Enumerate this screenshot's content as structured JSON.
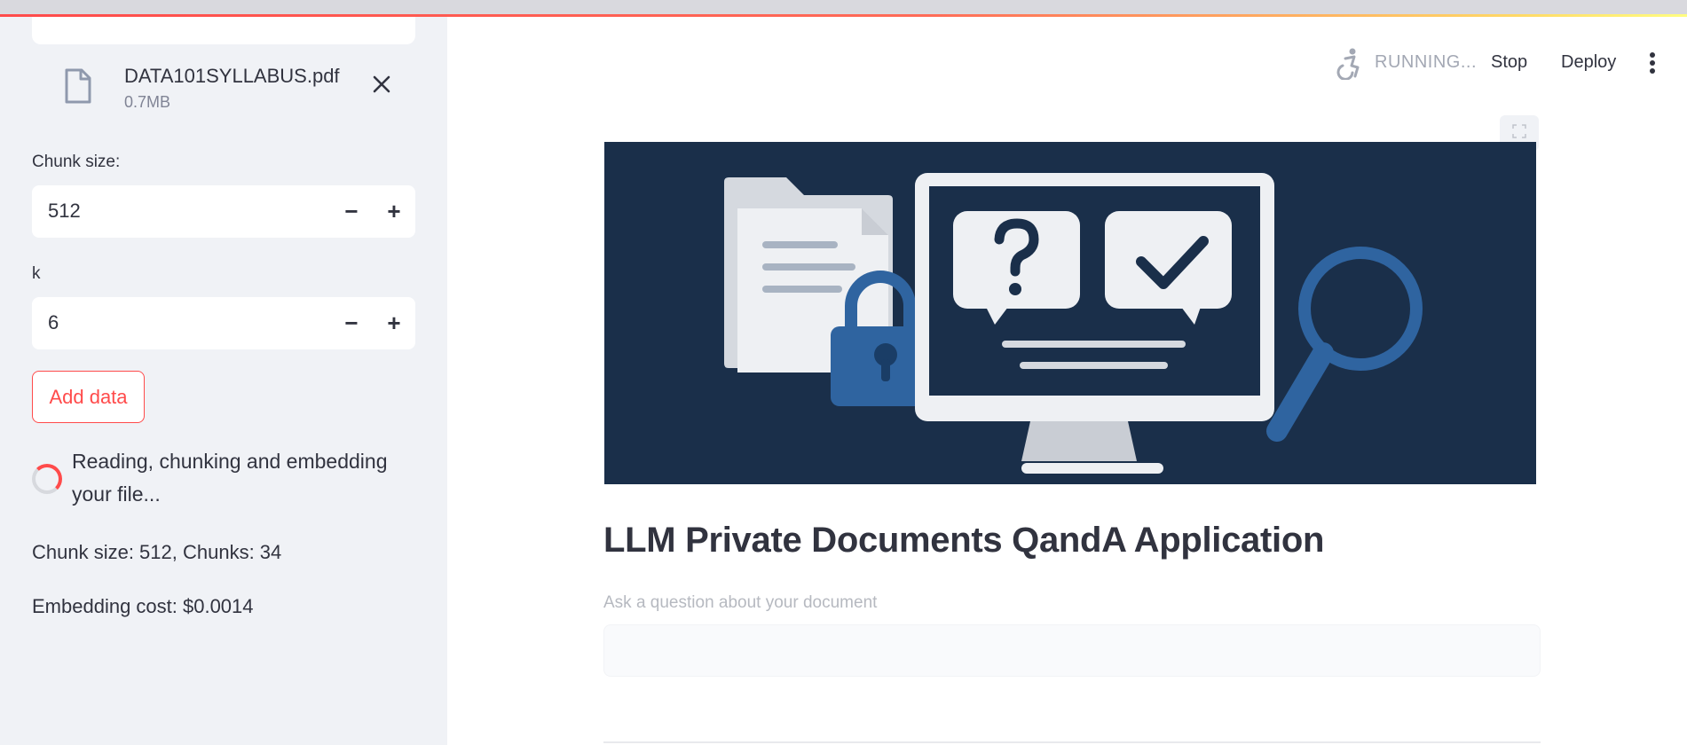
{
  "sidebar": {
    "file": {
      "name": "DATA101SYLLABUS.pdf",
      "size": "0.7MB"
    },
    "chunk_size": {
      "label": "Chunk size:",
      "value": "512"
    },
    "k": {
      "label": "k",
      "value": "6"
    },
    "add_button": "Add data",
    "status": "Reading, chunking and embedding your file...",
    "chunk_info": "Chunk size: 512, Chunks: 34",
    "embedding_cost": "Embedding cost: $0.0014"
  },
  "header": {
    "status": "RUNNING...",
    "stop_label": "Stop",
    "deploy_label": "Deploy"
  },
  "main": {
    "title": "LLM Private Documents QandA Application",
    "question_label": "Ask a question about your document",
    "question_value": ""
  },
  "colors": {
    "accent": "#ff4b4b",
    "sidebar_bg": "#f0f2f6",
    "hero_bg": "#1a2f4a"
  },
  "icons": {
    "file": "document-icon",
    "close": "close-icon",
    "running": "running-man-icon",
    "menu": "kebab-menu-icon",
    "fullscreen": "fullscreen-icon"
  }
}
